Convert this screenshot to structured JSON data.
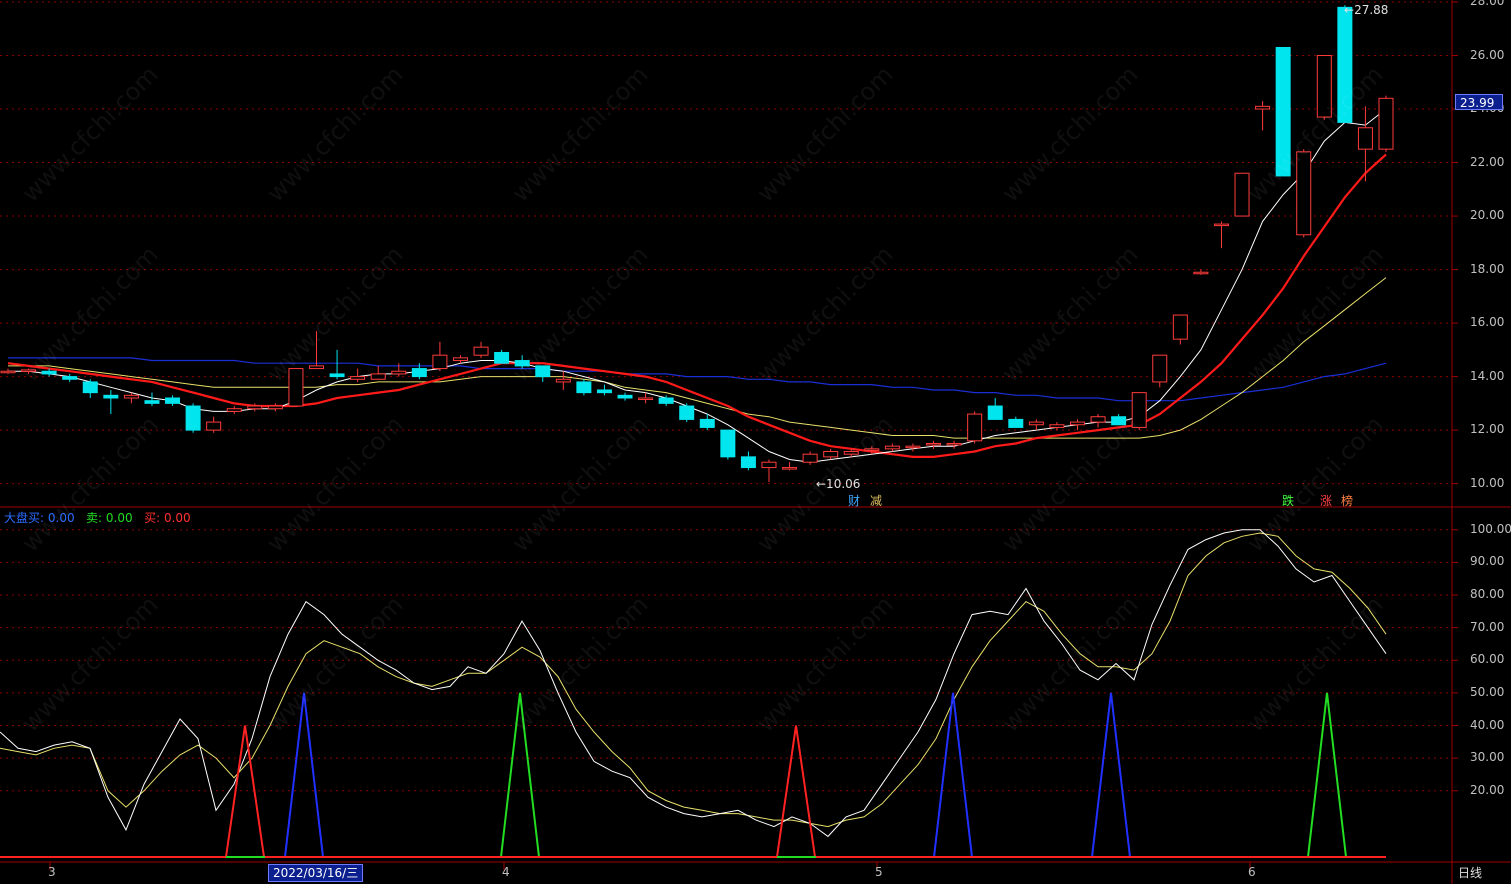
{
  "price_axis": [
    "28.00",
    "26.00",
    "24.00",
    "22.00",
    "20.00",
    "18.00",
    "16.00",
    "14.00",
    "12.00",
    "10.00"
  ],
  "indicator_axis": [
    "100.00",
    "90.00",
    "80.00",
    "70.00",
    "60.00",
    "50.00",
    "40.00",
    "30.00",
    "20.00"
  ],
  "date_ticks": [
    "3",
    "4",
    "5",
    "6"
  ],
  "cursor_date": "2022/03/16/三",
  "current_price": "23.99",
  "high_marker": "27.88",
  "low_marker": "←10.06",
  "period_label": "日线",
  "indicator_legend": {
    "item1_label": "大盘买:",
    "item1_value": "0.00",
    "item2_label": "卖:",
    "item2_value": "0.00",
    "item3_label": "买:",
    "item3_value": "0.00"
  },
  "event_tags": [
    "财",
    "减",
    "跌",
    "涨",
    "榜"
  ],
  "watermark": "www.cfchi.com",
  "colors": {
    "up": "#ff3b3b",
    "down": "#00e5ee",
    "ma_white": "#ffffff",
    "ma_red": "#ff1a1a",
    "ma_yellow": "#e8e06a",
    "ma_blue": "#1a2fd6",
    "grid": "#8b0000",
    "buy": "#ff2222",
    "sell": "#22dd22",
    "market_buy": "#2030ff"
  },
  "chart_data": [
    {
      "type": "candlestick",
      "ylim": [
        9.5,
        28.0
      ],
      "candles_ohlc": [
        [
          14.2,
          14.3,
          14.1,
          14.2
        ],
        [
          14.2,
          14.3,
          14.1,
          14.25
        ],
        [
          14.2,
          14.3,
          14.0,
          14.1
        ],
        [
          14.0,
          14.1,
          13.8,
          13.9
        ],
        [
          13.8,
          13.9,
          13.2,
          13.4
        ],
        [
          13.3,
          13.5,
          12.6,
          13.2
        ],
        [
          13.2,
          13.4,
          13.0,
          13.3
        ],
        [
          13.1,
          13.4,
          12.9,
          13.0
        ],
        [
          13.2,
          13.3,
          12.9,
          13.0
        ],
        [
          12.9,
          13.0,
          11.9,
          12.0
        ],
        [
          12.0,
          12.5,
          11.9,
          12.3
        ],
        [
          12.7,
          12.9,
          12.6,
          12.8
        ],
        [
          12.8,
          13.0,
          12.7,
          12.9
        ],
        [
          12.8,
          13.0,
          12.7,
          12.9
        ],
        [
          12.9,
          14.3,
          12.9,
          14.3
        ],
        [
          14.3,
          15.7,
          14.3,
          14.4
        ],
        [
          14.1,
          15.0,
          13.9,
          14.0
        ],
        [
          13.9,
          14.3,
          13.8,
          14.0
        ],
        [
          13.9,
          14.4,
          13.9,
          14.1
        ],
        [
          14.1,
          14.5,
          14.0,
          14.2
        ],
        [
          14.3,
          14.5,
          13.9,
          14.0
        ],
        [
          14.3,
          15.3,
          14.2,
          14.8
        ],
        [
          14.6,
          14.8,
          14.5,
          14.7
        ],
        [
          14.8,
          15.3,
          14.7,
          15.1
        ],
        [
          14.9,
          15.0,
          14.5,
          14.5
        ],
        [
          14.6,
          14.8,
          14.3,
          14.4
        ],
        [
          14.4,
          14.4,
          13.8,
          14.0
        ],
        [
          13.8,
          14.2,
          13.5,
          13.9
        ],
        [
          13.8,
          13.9,
          13.3,
          13.4
        ],
        [
          13.5,
          13.7,
          13.3,
          13.4
        ],
        [
          13.3,
          13.4,
          13.1,
          13.2
        ],
        [
          13.2,
          13.4,
          13.0,
          13.2
        ],
        [
          13.2,
          13.3,
          12.9,
          13.0
        ],
        [
          12.9,
          13.0,
          12.3,
          12.4
        ],
        [
          12.4,
          12.6,
          12.0,
          12.1
        ],
        [
          12.0,
          12.0,
          10.9,
          11.0
        ],
        [
          11.0,
          11.2,
          10.5,
          10.6
        ],
        [
          10.6,
          10.9,
          10.06,
          10.8
        ],
        [
          10.6,
          10.8,
          10.5,
          10.6
        ],
        [
          10.8,
          11.2,
          10.7,
          11.1
        ],
        [
          11.0,
          11.3,
          10.9,
          11.2
        ],
        [
          11.1,
          11.3,
          11.0,
          11.2
        ],
        [
          11.3,
          11.4,
          11.1,
          11.3
        ],
        [
          11.3,
          11.5,
          11.2,
          11.4
        ],
        [
          11.4,
          11.5,
          11.2,
          11.4
        ],
        [
          11.5,
          11.6,
          11.3,
          11.5
        ],
        [
          11.5,
          11.6,
          11.3,
          11.5
        ],
        [
          11.6,
          12.7,
          11.5,
          12.6
        ],
        [
          12.9,
          13.2,
          12.4,
          12.4
        ],
        [
          12.4,
          12.5,
          12.1,
          12.1
        ],
        [
          12.2,
          12.4,
          12.0,
          12.3
        ],
        [
          12.1,
          12.3,
          12.0,
          12.2
        ],
        [
          12.2,
          12.4,
          12.0,
          12.3
        ],
        [
          12.3,
          12.6,
          12.1,
          12.5
        ],
        [
          12.5,
          12.6,
          12.2,
          12.2
        ],
        [
          12.1,
          13.4,
          12.0,
          13.4
        ],
        [
          13.8,
          14.8,
          13.6,
          14.8
        ],
        [
          15.4,
          16.3,
          15.2,
          16.3
        ],
        [
          17.9,
          18.0,
          17.8,
          17.9
        ],
        [
          19.7,
          19.8,
          18.8,
          19.7
        ],
        [
          20.0,
          21.6,
          20.0,
          21.6
        ],
        [
          24.0,
          24.3,
          23.2,
          24.1
        ],
        [
          26.3,
          26.3,
          21.5,
          21.5
        ],
        [
          19.3,
          22.5,
          19.2,
          22.4
        ],
        [
          23.7,
          26.0,
          23.6,
          26.0
        ],
        [
          27.8,
          27.88,
          23.5,
          23.5
        ],
        [
          22.5,
          24.1,
          21.3,
          23.3
        ],
        [
          22.5,
          24.5,
          22.4,
          24.4
        ]
      ],
      "ma_white": [
        14.2,
        14.2,
        14.1,
        14.0,
        13.8,
        13.6,
        13.4,
        13.2,
        13.1,
        12.8,
        12.7,
        12.7,
        12.8,
        12.8,
        13.1,
        13.5,
        13.8,
        14.0,
        14.1,
        14.1,
        14.2,
        14.3,
        14.5,
        14.6,
        14.6,
        14.5,
        14.3,
        14.2,
        14.0,
        13.8,
        13.5,
        13.4,
        13.2,
        12.9,
        12.6,
        12.2,
        11.7,
        11.2,
        10.9,
        10.8,
        10.9,
        11.0,
        11.1,
        11.2,
        11.3,
        11.4,
        11.4,
        11.6,
        11.8,
        11.9,
        12.0,
        12.1,
        12.2,
        12.3,
        12.3,
        12.5,
        13.1,
        14.0,
        15.0,
        16.5,
        18.0,
        19.8,
        20.8,
        21.6,
        22.8,
        23.5,
        23.4,
        24.0
      ],
      "ma_red": [
        14.5,
        14.4,
        14.3,
        14.2,
        14.1,
        14.0,
        13.9,
        13.8,
        13.6,
        13.4,
        13.2,
        13.0,
        12.9,
        12.9,
        12.9,
        13.0,
        13.2,
        13.3,
        13.4,
        13.5,
        13.7,
        13.9,
        14.1,
        14.3,
        14.5,
        14.5,
        14.5,
        14.4,
        14.3,
        14.2,
        14.1,
        14.0,
        13.8,
        13.5,
        13.2,
        12.9,
        12.5,
        12.2,
        11.9,
        11.6,
        11.4,
        11.3,
        11.2,
        11.1,
        11.0,
        11.0,
        11.1,
        11.2,
        11.4,
        11.5,
        11.7,
        11.8,
        11.9,
        12.0,
        12.1,
        12.2,
        12.6,
        13.2,
        13.8,
        14.5,
        15.4,
        16.3,
        17.3,
        18.5,
        19.6,
        20.7,
        21.6,
        22.3
      ],
      "ma_yellow": [
        14.4,
        14.4,
        14.4,
        14.3,
        14.2,
        14.1,
        14.0,
        13.9,
        13.8,
        13.7,
        13.6,
        13.6,
        13.6,
        13.6,
        13.6,
        13.6,
        13.7,
        13.7,
        13.8,
        13.8,
        13.8,
        13.8,
        13.9,
        14.0,
        14.0,
        14.0,
        14.0,
        14.0,
        13.9,
        13.8,
        13.6,
        13.5,
        13.4,
        13.2,
        13.0,
        12.8,
        12.6,
        12.5,
        12.3,
        12.2,
        12.1,
        12.0,
        11.9,
        11.8,
        11.8,
        11.8,
        11.7,
        11.7,
        11.7,
        11.7,
        11.7,
        11.7,
        11.7,
        11.7,
        11.7,
        11.7,
        11.8,
        12.0,
        12.4,
        12.9,
        13.4,
        14.0,
        14.6,
        15.3,
        15.9,
        16.5,
        17.1,
        17.7
      ],
      "ma_blue": [
        14.7,
        14.7,
        14.7,
        14.7,
        14.7,
        14.7,
        14.7,
        14.6,
        14.6,
        14.6,
        14.6,
        14.6,
        14.5,
        14.5,
        14.5,
        14.5,
        14.5,
        14.5,
        14.4,
        14.4,
        14.4,
        14.4,
        14.4,
        14.3,
        14.3,
        14.3,
        14.3,
        14.2,
        14.2,
        14.2,
        14.1,
        14.1,
        14.1,
        14.0,
        14.0,
        14.0,
        13.9,
        13.9,
        13.8,
        13.8,
        13.7,
        13.7,
        13.7,
        13.6,
        13.6,
        13.5,
        13.5,
        13.4,
        13.4,
        13.3,
        13.3,
        13.2,
        13.2,
        13.2,
        13.1,
        13.1,
        13.1,
        13.1,
        13.2,
        13.3,
        13.4,
        13.5,
        13.6,
        13.8,
        14.0,
        14.1,
        14.3,
        14.5
      ]
    },
    {
      "type": "line",
      "ylim": [
        0,
        103
      ],
      "white": [
        38,
        33,
        32,
        34,
        35,
        33,
        18,
        8,
        22,
        32,
        42,
        36,
        14,
        22,
        36,
        55,
        68,
        78,
        74,
        68,
        64,
        60,
        57,
        53,
        51,
        52,
        58,
        56,
        62,
        72,
        63,
        50,
        38,
        29,
        26,
        24,
        18,
        15,
        13,
        12,
        13,
        14,
        11,
        9,
        12,
        10,
        6,
        12,
        14,
        22,
        30,
        38,
        48,
        62,
        74,
        75,
        74,
        82,
        72,
        65,
        57,
        54,
        59,
        54,
        71,
        83,
        94,
        97,
        99,
        100,
        100,
        95,
        88,
        84,
        86,
        78,
        70,
        62
      ],
      "yellow": [
        33,
        32,
        31,
        33,
        34,
        33,
        20,
        15,
        20,
        26,
        31,
        34,
        30,
        24,
        30,
        40,
        52,
        62,
        66,
        64,
        62,
        58,
        55,
        53,
        52,
        54,
        56,
        56,
        60,
        64,
        61,
        55,
        45,
        38,
        32,
        27,
        20,
        17,
        15,
        14,
        13,
        13,
        12,
        11,
        11,
        10,
        9,
        11,
        12,
        16,
        22,
        28,
        36,
        48,
        58,
        66,
        72,
        78,
        75,
        68,
        62,
        58,
        58,
        57,
        62,
        72,
        86,
        92,
        96,
        98,
        99,
        98,
        92,
        88,
        87,
        82,
        76,
        68
      ]
    }
  ]
}
